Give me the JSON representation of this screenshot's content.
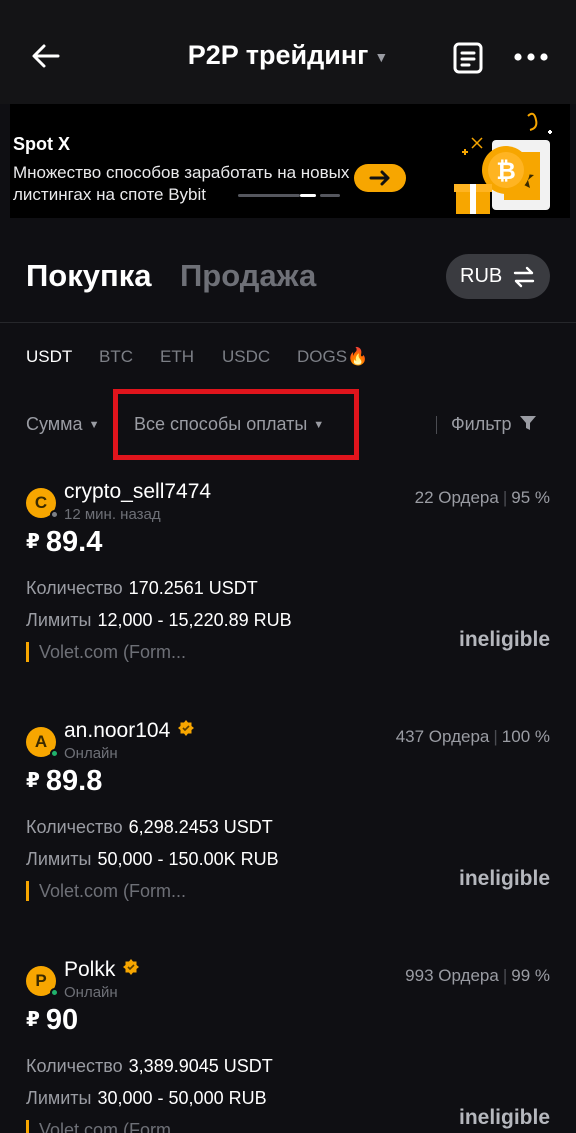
{
  "header": {
    "title": "P2P трейдинг"
  },
  "banner": {
    "title": "Spot X",
    "text": "Множество способов заработать на новых листингах на споте Bybit"
  },
  "tabs": {
    "buy": "Покупка",
    "sell": "Продажа",
    "currency": "RUB"
  },
  "coins": [
    "USDT",
    "BTC",
    "ETH",
    "USDC",
    "DOGS"
  ],
  "filters": {
    "amount": "Сумма",
    "payment": "Все способы оплаты",
    "filter": "Фильтр"
  },
  "labels": {
    "quantity": "Количество",
    "limits": "Лимиты",
    "ineligible": "ineligible",
    "currency_symbol": "₽"
  },
  "ads": [
    {
      "initial": "C",
      "name": "crypto_sell7474",
      "verified": false,
      "status": "12 мин. назад",
      "status_color": "#7c7f86",
      "orders": "22 Ордера",
      "completion": "95 %",
      "price": "89.4",
      "quantity": "170.2561 USDT",
      "limits": "12,000 - 15,220.89 RUB",
      "payment": "Volet.com (Form..."
    },
    {
      "initial": "A",
      "name": "an.noor104",
      "verified": true,
      "status": "Онлайн",
      "status_color": "#20b26c",
      "orders": "437 Ордера",
      "completion": "100 %",
      "price": "89.8",
      "quantity": "6,298.2453 USDT",
      "limits": "50,000 - 150.00K RUB",
      "payment": "Volet.com (Form..."
    },
    {
      "initial": "P",
      "name": "Polkk",
      "verified": true,
      "status": "Онлайн",
      "status_color": "#20b26c",
      "orders": "993 Ордера",
      "completion": "99 %",
      "price": "90",
      "quantity": "3,389.9045 USDT",
      "limits": "30,000 - 50,000 RUB",
      "payment": "Volet.com (Form..."
    }
  ],
  "icons": {
    "back": "back-arrow-icon",
    "orders": "orders-list-icon",
    "more": "more-dots-icon",
    "swap": "swap-arrows-icon",
    "filter": "funnel-icon",
    "fire": "fire-icon",
    "verified": "verified-badge-icon"
  },
  "colors": {
    "accent": "#f7a600",
    "background": "#0f0f13",
    "highlight": "#e0141c",
    "online": "#20b26c"
  }
}
